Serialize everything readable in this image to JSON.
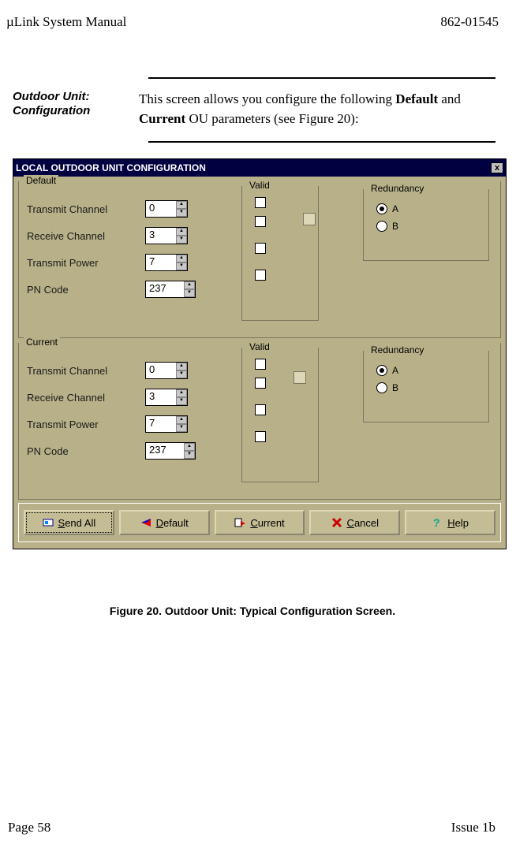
{
  "headerLeft": "µLink System Manual",
  "headerRight": "862-01545",
  "marginTitle": "Outdoor Unit: Configuration",
  "bodyLine1": "This screen allows you configure the following ",
  "bodyBold1": "Default",
  "bodyMid": " and ",
  "bodyBold2": "Current",
  "bodyTail": " OU parameters (see Figure 20):",
  "dialog": {
    "title": "LOCAL OUTDOOR UNIT CONFIGURATION",
    "close": "x",
    "defaultLabel": "Default",
    "currentLabel": "Current",
    "validLabel": "Valid",
    "redundancyLabel": "Redundancy",
    "redA": "A",
    "redB": "B",
    "fields": {
      "transmitChannel": "Transmit Channel",
      "receiveChannel": "Receive Channel",
      "transmitPower": "Transmit Power",
      "pnCode": "PN Code"
    },
    "defaultVals": {
      "tx": "0",
      "rx": "3",
      "pw": "7",
      "pn": "237"
    },
    "currentVals": {
      "tx": "0",
      "rx": "3",
      "pw": "7",
      "pn": "237"
    },
    "buttons": {
      "sendAll": "Send All",
      "default": "Default",
      "current": "Current",
      "cancel": "Cancel",
      "help": "Help"
    }
  },
  "figureCaption": "Figure 20.  Outdoor Unit:  Typical Configuration Screen.",
  "footerLeft": "Page 58",
  "footerRight": "Issue 1b"
}
